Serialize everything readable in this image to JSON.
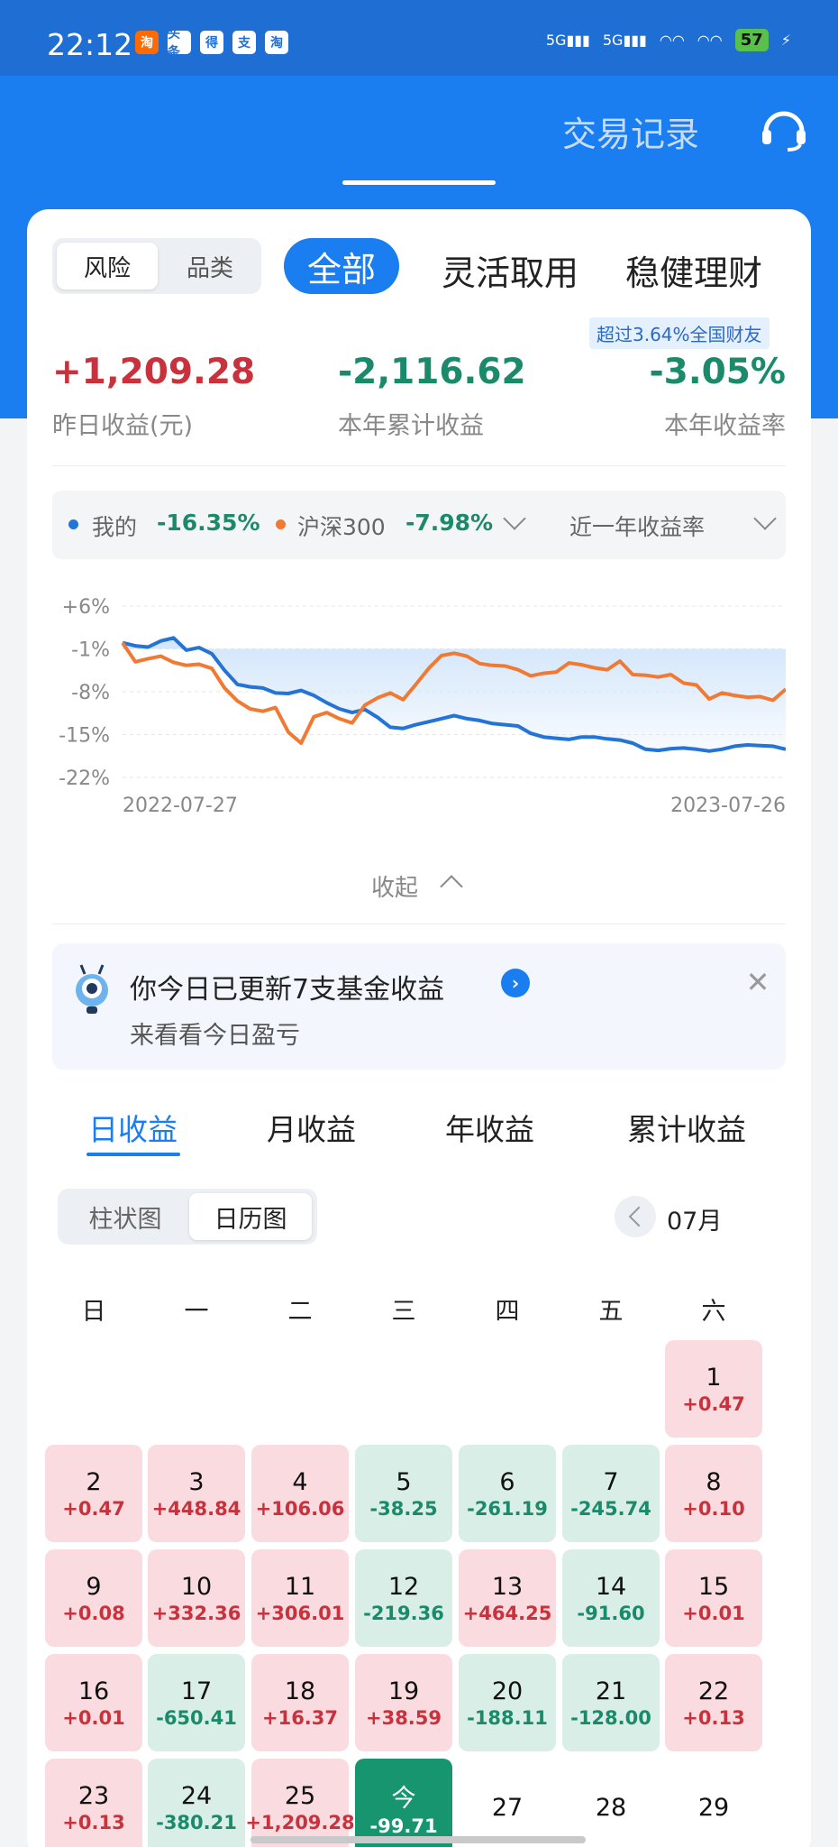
{
  "status_bar": {
    "time": "22:12",
    "battery": "57",
    "app_icons": [
      "淘",
      "头条",
      "得",
      "支",
      "淘"
    ]
  },
  "header": {
    "title": "交易记录"
  },
  "filters": {
    "risk": "风险",
    "category": "品类",
    "tabs": [
      "全部",
      "灵活取用",
      "稳健理财"
    ]
  },
  "rank_badge": "超过3.64%全国财友",
  "stats": [
    {
      "value": "+1,209.28",
      "label": "昨日收益(元)"
    },
    {
      "value": "-2,116.62",
      "label": "本年累计收益"
    },
    {
      "value": "-3.05%",
      "label": "本年收益率"
    }
  ],
  "legend": {
    "mine_label": "我的",
    "mine_value": "-16.35%",
    "bench_label": "沪深300",
    "bench_value": "-7.98%",
    "period": "近一年收益率"
  },
  "chart_data": {
    "type": "line",
    "y_ticks": [
      "+6%",
      "-1%",
      "-8%",
      "-15%",
      "-22%"
    ],
    "x_range": [
      "2022-07-27",
      "2023-07-26"
    ],
    "ylim": [
      -22,
      6
    ],
    "series": [
      {
        "name": "我的",
        "color": "#2473d6",
        "values": [
          0,
          -0.5,
          -0.7,
          0.3,
          0.8,
          -1.2,
          -0.8,
          -1.8,
          -4.5,
          -6.8,
          -7.2,
          -7.4,
          -8.2,
          -8.3,
          -7.8,
          -8.6,
          -9.8,
          -10.8,
          -11.4,
          -10.9,
          -12.2,
          -13.8,
          -14.0,
          -13.4,
          -12.9,
          -12.4,
          -11.9,
          -12.4,
          -12.7,
          -13.2,
          -13.4,
          -13.6,
          -14.8,
          -15.4,
          -15.6,
          -15.8,
          -15.4,
          -15.4,
          -15.7,
          -15.9,
          -16.4,
          -17.4,
          -17.6,
          -17.3,
          -17.2,
          -17.4,
          -17.7,
          -17.4,
          -16.9,
          -16.7,
          -16.8,
          -16.9,
          -17.4
        ]
      },
      {
        "name": "沪深300",
        "color": "#f07a33",
        "values": [
          0,
          -3.1,
          -2.6,
          -2.2,
          -3.2,
          -3.7,
          -3.5,
          -4.2,
          -7.4,
          -9.5,
          -10.8,
          -11.2,
          -10.6,
          -14.6,
          -16.4,
          -12.1,
          -11.4,
          -12.4,
          -13.1,
          -10.2,
          -9.0,
          -8.2,
          -9.3,
          -6.8,
          -4.2,
          -2.1,
          -1.7,
          -2.2,
          -3.4,
          -3.7,
          -3.8,
          -4.4,
          -5.4,
          -5.0,
          -4.8,
          -3.3,
          -3.6,
          -4.1,
          -4.4,
          -3.0,
          -5.2,
          -5.3,
          -5.6,
          -5.2,
          -6.6,
          -6.9,
          -9.2,
          -8.2,
          -8.6,
          -8.9,
          -8.8,
          -9.4,
          -7.6
        ]
      }
    ]
  },
  "collapse": {
    "label": "收起"
  },
  "notice": {
    "title": "你今日已更新7支基金收益",
    "subtitle": "来看看今日盈亏"
  },
  "profit_tabs": [
    "日收益",
    "月收益",
    "年收益",
    "累计收益"
  ],
  "view_toggle": {
    "bar": "柱状图",
    "calendar": "日历图"
  },
  "month": "07月",
  "weekdays": [
    "日",
    "一",
    "二",
    "三",
    "四",
    "五",
    "六"
  ],
  "days": [
    {
      "d": "1",
      "v": "+0.47",
      "t": "pos"
    },
    {
      "d": "2",
      "v": "+0.47",
      "t": "pos"
    },
    {
      "d": "3",
      "v": "+448.84",
      "t": "pos"
    },
    {
      "d": "4",
      "v": "+106.06",
      "t": "pos"
    },
    {
      "d": "5",
      "v": "-38.25",
      "t": "neg"
    },
    {
      "d": "6",
      "v": "-261.19",
      "t": "neg"
    },
    {
      "d": "7",
      "v": "-245.74",
      "t": "neg"
    },
    {
      "d": "8",
      "v": "+0.10",
      "t": "pos"
    },
    {
      "d": "9",
      "v": "+0.08",
      "t": "pos"
    },
    {
      "d": "10",
      "v": "+332.36",
      "t": "pos"
    },
    {
      "d": "11",
      "v": "+306.01",
      "t": "pos"
    },
    {
      "d": "12",
      "v": "-219.36",
      "t": "neg"
    },
    {
      "d": "13",
      "v": "+464.25",
      "t": "pos"
    },
    {
      "d": "14",
      "v": "-91.60",
      "t": "neg"
    },
    {
      "d": "15",
      "v": "+0.01",
      "t": "pos"
    },
    {
      "d": "16",
      "v": "+0.01",
      "t": "pos"
    },
    {
      "d": "17",
      "v": "-650.41",
      "t": "neg"
    },
    {
      "d": "18",
      "v": "+16.37",
      "t": "pos"
    },
    {
      "d": "19",
      "v": "+38.59",
      "t": "pos"
    },
    {
      "d": "20",
      "v": "-188.11",
      "t": "neg"
    },
    {
      "d": "21",
      "v": "-128.00",
      "t": "neg"
    },
    {
      "d": "22",
      "v": "+0.13",
      "t": "pos"
    },
    {
      "d": "23",
      "v": "+0.13",
      "t": "pos"
    },
    {
      "d": "24",
      "v": "-380.21",
      "t": "neg"
    },
    {
      "d": "25",
      "v": "+1,209.28",
      "t": "pos"
    },
    {
      "d": "今",
      "v": "-99.71",
      "t": "today"
    },
    {
      "d": "27",
      "v": "",
      "t": "future"
    },
    {
      "d": "28",
      "v": "",
      "t": "future"
    },
    {
      "d": "29",
      "v": "",
      "t": "future"
    }
  ]
}
